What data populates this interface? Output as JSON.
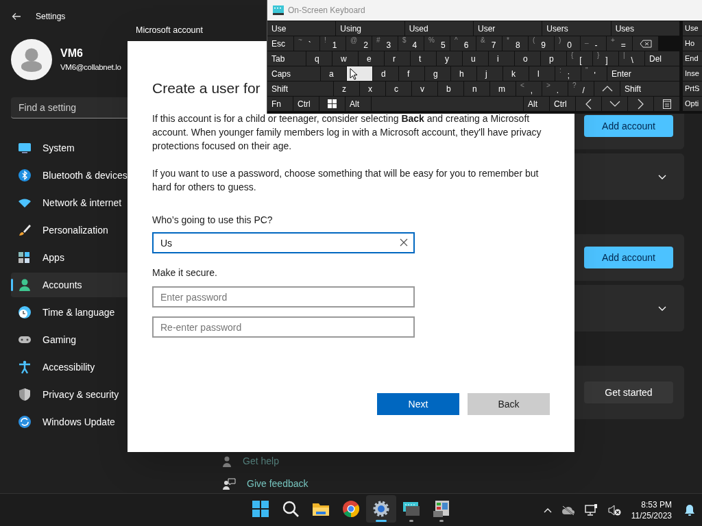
{
  "settings": {
    "title": "Settings",
    "user": {
      "name": "VM6",
      "email": "VM6@collabnet.lo"
    },
    "search": {
      "placeholder": "Find a setting"
    },
    "nav": [
      {
        "kind": "system",
        "label": "System",
        "selected": false
      },
      {
        "kind": "bluetooth",
        "label": "Bluetooth & devices",
        "selected": false
      },
      {
        "kind": "network",
        "label": "Network & internet",
        "selected": false
      },
      {
        "kind": "personalization",
        "label": "Personalization",
        "selected": false
      },
      {
        "kind": "apps",
        "label": "Apps",
        "selected": false
      },
      {
        "kind": "accounts",
        "label": "Accounts",
        "selected": true
      },
      {
        "kind": "time",
        "label": "Time & language",
        "selected": false
      },
      {
        "kind": "gaming",
        "label": "Gaming",
        "selected": false
      },
      {
        "kind": "accessibility",
        "label": "Accessibility",
        "selected": false
      },
      {
        "kind": "privacy",
        "label": "Privacy & security",
        "selected": false
      },
      {
        "kind": "update",
        "label": "Windows Update",
        "selected": false
      }
    ],
    "sections": [
      {
        "cards": [
          {
            "kind": "accent-button",
            "label": "Add account"
          },
          {
            "kind": "expander"
          }
        ]
      },
      {
        "cards": [
          {
            "kind": "accent-button",
            "label": "Add account"
          },
          {
            "kind": "expander"
          }
        ]
      },
      {
        "cards": [
          {
            "kind": "button",
            "label": "Get started"
          }
        ]
      }
    ],
    "links": [
      {
        "kind": "help",
        "label": "Get help"
      },
      {
        "kind": "feedback",
        "label": "Give feedback"
      }
    ]
  },
  "dialog": {
    "title": "Microsoft account",
    "heading": "Create a user for",
    "paragraphs": [
      "If this account is for a child or teenager, consider selecting **Back** and creating a Microsoft account. When younger family members log in with a Microsoft account, they'll have privacy protections focused on their age.",
      "If you want to use a password, choose something that will be easy for you to remember but hard for others to guess."
    ],
    "user_label": "Who’s going to use this PC?",
    "user_value": "Us",
    "secure_label": "Make it secure.",
    "password_placeholder": "Enter password",
    "reenter_placeholder": "Re-enter password",
    "buttons": [
      {
        "kind": "primary",
        "label": "Next"
      },
      {
        "kind": "secondary",
        "label": "Back"
      }
    ]
  },
  "keyboard": {
    "title": "On-Screen Keyboard",
    "suggestions": [
      "Use",
      "Using",
      "Used",
      "User",
      "Users",
      "Uses"
    ],
    "suggestion_side": "Use",
    "rows": [
      {
        "side": "Ho",
        "keys": [
          {
            "label": "Esc"
          },
          {
            "shift": "~",
            "label": "`"
          },
          {
            "shift": "!",
            "label": "1"
          },
          {
            "shift": "@",
            "label": "2"
          },
          {
            "shift": "#",
            "label": "3"
          },
          {
            "shift": "$",
            "label": "4"
          },
          {
            "shift": "%",
            "label": "5"
          },
          {
            "shift": "^",
            "label": "6"
          },
          {
            "shift": "&",
            "label": "7"
          },
          {
            "shift": "*",
            "label": "8"
          },
          {
            "shift": "(",
            "label": "9"
          },
          {
            "shift": ")",
            "label": "0"
          },
          {
            "shift": "_",
            "label": "-"
          },
          {
            "shift": "+",
            "label": "="
          },
          {
            "kind": "backspace"
          }
        ]
      },
      {
        "side": "End",
        "keys": [
          {
            "label": "Tab"
          },
          {
            "label": "q"
          },
          {
            "label": "w"
          },
          {
            "label": "e"
          },
          {
            "label": "r"
          },
          {
            "label": "t"
          },
          {
            "label": "y"
          },
          {
            "label": "u"
          },
          {
            "label": "i"
          },
          {
            "label": "o"
          },
          {
            "label": "p"
          },
          {
            "shift": "{",
            "label": "["
          },
          {
            "shift": "}",
            "label": "]"
          },
          {
            "shift": "|",
            "label": "\\"
          },
          {
            "kind": "grow",
            "label": "Del"
          }
        ]
      },
      {
        "side": "Inse",
        "keys": [
          {
            "label": "Caps"
          },
          {
            "label": "a"
          },
          {
            "hovered": true
          },
          {
            "label": "d"
          },
          {
            "label": "f"
          },
          {
            "label": "g"
          },
          {
            "label": "h"
          },
          {
            "label": "j"
          },
          {
            "label": "k"
          },
          {
            "label": "l"
          },
          {
            "shift": ":",
            "label": ";"
          },
          {
            "shift": "\"",
            "label": "'"
          },
          {
            "kind": "grow",
            "label": "Enter"
          }
        ]
      },
      {
        "side": "PrtS",
        "keys": [
          {
            "label": "Shift"
          },
          {
            "label": "z"
          },
          {
            "label": "x"
          },
          {
            "label": "c"
          },
          {
            "label": "v"
          },
          {
            "label": "b"
          },
          {
            "label": "n"
          },
          {
            "label": "m"
          },
          {
            "shift": "<",
            "label": ","
          },
          {
            "shift": ">",
            "label": "."
          },
          {
            "shift": "?",
            "label": "/"
          },
          {
            "kind": "up"
          },
          {
            "kind": "grow",
            "label": "Shift"
          }
        ]
      },
      {
        "side": "Opti",
        "keys": [
          {
            "label": "Fn"
          },
          {
            "label": "Ctrl"
          },
          {
            "kind": "windows"
          },
          {
            "label": "Alt"
          },
          {
            "kind": "space"
          },
          {
            "label": "Alt"
          },
          {
            "label": "Ctrl"
          },
          {
            "kind": "left"
          },
          {
            "kind": "down"
          },
          {
            "kind": "right"
          },
          {
            "kind": "menu"
          }
        ]
      }
    ]
  },
  "taskbar": {
    "apps": [
      {
        "kind": "start",
        "running": false,
        "selected": false
      },
      {
        "kind": "search",
        "running": false,
        "selected": false
      },
      {
        "kind": "explorer",
        "running": false,
        "selected": false
      },
      {
        "kind": "chrome",
        "running": false,
        "selected": false
      },
      {
        "kind": "settings",
        "running": true,
        "selected": true
      },
      {
        "kind": "keyboard",
        "running": true,
        "selected": false
      },
      {
        "kind": "control-panel",
        "running": true,
        "selected": false
      }
    ],
    "time": "8:53 PM",
    "date": "11/25/2023"
  }
}
